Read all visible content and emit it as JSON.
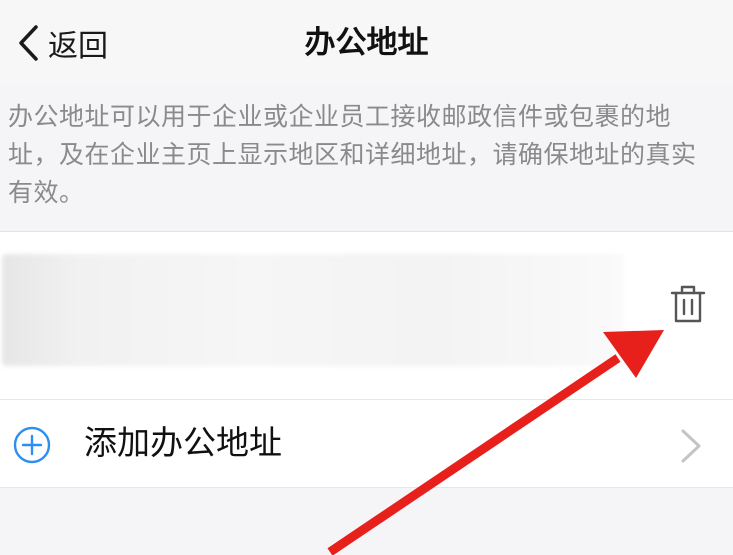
{
  "header": {
    "back_label": "返回",
    "title": "办公地址"
  },
  "description": "办公地址可以用于企业或企业员工接收邮政信件或包裹的地址，及在企业主页上显示地区和详细地址，请确保地址的真实有效。",
  "add_address": {
    "label": "添加办公地址"
  },
  "icons": {
    "back": "chevron-left-icon",
    "delete": "trash-icon",
    "add": "plus-circle-icon",
    "navigate": "chevron-right-icon"
  },
  "colors": {
    "accent": "#2f8ff0",
    "annotation_arrow": "#e8201c",
    "background": "#f5f5f7",
    "description_text": "#8a8a8a"
  }
}
